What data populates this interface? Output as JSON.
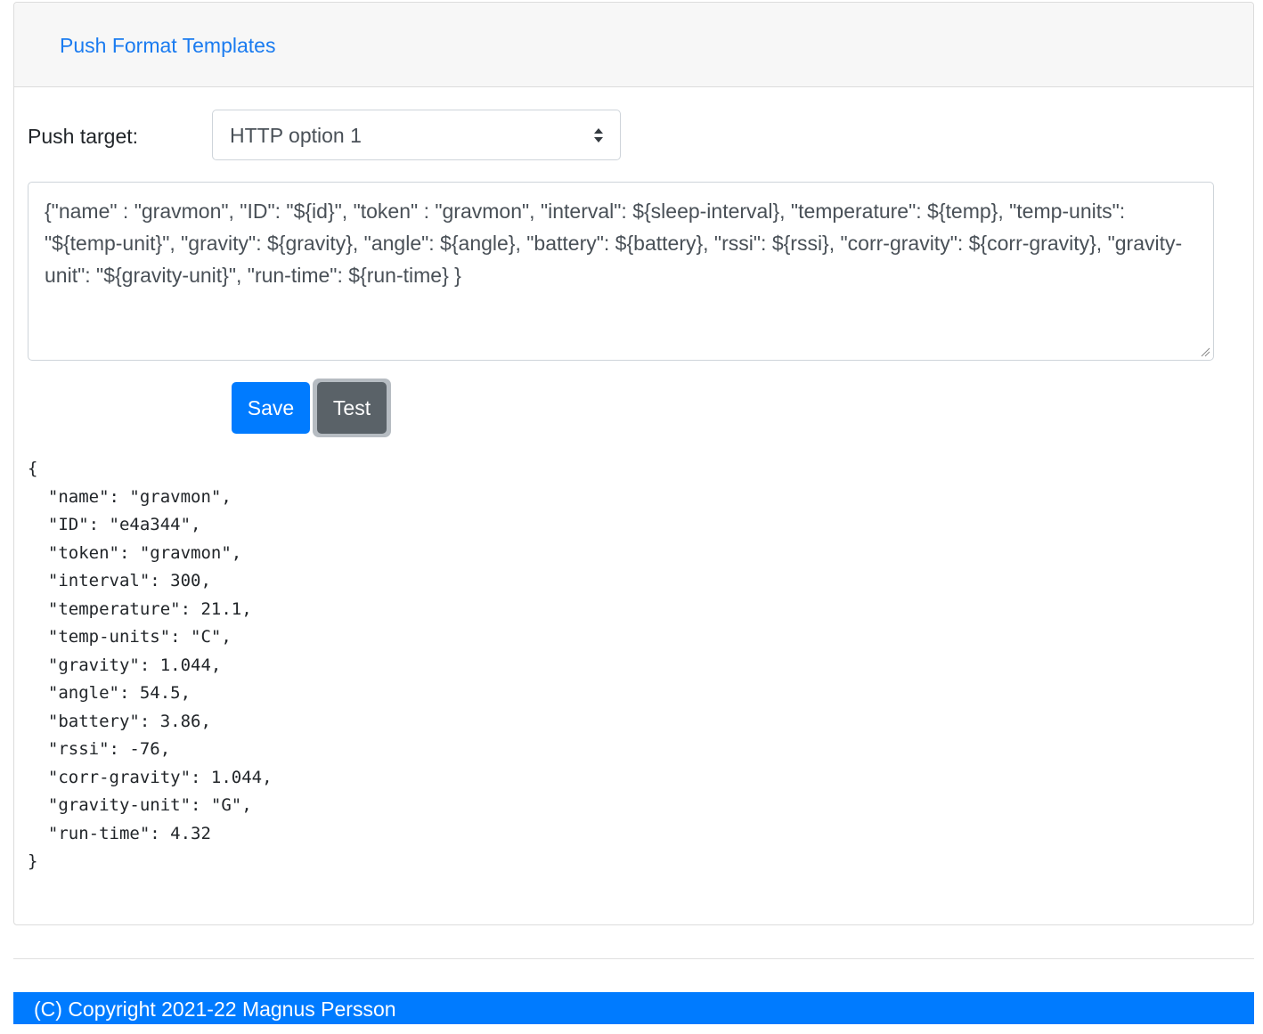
{
  "header": {
    "title": "Push Format Templates"
  },
  "form": {
    "push_target_label": "Push target:",
    "push_target_value": "HTTP option 1",
    "template_text": "{\"name\" : \"gravmon\", \"ID\": \"${id}\", \"token\" : \"gravmon\", \"interval\": ${sleep-interval}, \"temperature\": ${temp}, \"temp-units\": \"${temp-unit}\", \"gravity\": ${gravity}, \"angle\": ${angle}, \"battery\": ${battery}, \"rssi\": ${rssi}, \"corr-gravity\": ${corr-gravity}, \"gravity-unit\": \"${gravity-unit}\", \"run-time\": ${run-time} }",
    "save_label": "Save",
    "test_label": "Test"
  },
  "test_output": "{\n  \"name\": \"gravmon\",\n  \"ID\": \"e4a344\",\n  \"token\": \"gravmon\",\n  \"interval\": 300,\n  \"temperature\": 21.1,\n  \"temp-units\": \"C\",\n  \"gravity\": 1.044,\n  \"angle\": 54.5,\n  \"battery\": 3.86,\n  \"rssi\": -76,\n  \"corr-gravity\": 1.044,\n  \"gravity-unit\": \"G\",\n  \"run-time\": 4.32\n}",
  "footer": {
    "copyright": "(C) Copyright 2021-22 Magnus Persson"
  },
  "colors": {
    "primary": "#007bff",
    "link": "#1a7bf0",
    "secondary": "#5a6268"
  },
  "icons": {
    "select_arrows": "sort-arrows-icon",
    "resize": "resize-grip-icon"
  }
}
